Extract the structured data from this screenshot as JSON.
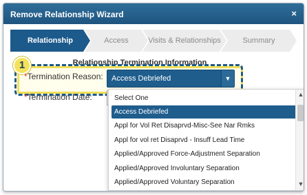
{
  "dialog": {
    "title": "Remove Relationship Wizard",
    "close_label": "×"
  },
  "steps": [
    {
      "label": "Relationship"
    },
    {
      "label": "Access"
    },
    {
      "label": "Visits & Relationships"
    },
    {
      "label": "Summary"
    }
  ],
  "section": {
    "title": "Relationship Termination Information"
  },
  "callout": {
    "number": "1"
  },
  "form": {
    "required_mark": "*",
    "reason_label": "Termination Reason:",
    "reason_value": "Access Debriefed",
    "date_label": "Termination Date:"
  },
  "dropdown": {
    "options": [
      "Select One",
      "Access Debriefed",
      "Appl for Vol Ret Disaprvd-Misc-See Nar Rmks",
      "Appl for vol ret Disaprvd - Insuff Lead Time",
      "Applied/Approved Force-Adjustment Separation",
      "Applied/Approved Involuntary Separation",
      "Applied/Approved Voluntary Separation"
    ],
    "selected_index": 1
  },
  "colors": {
    "accent": "#1f5d8d",
    "highlight": "#f1e05a",
    "required": "#dd3333"
  }
}
